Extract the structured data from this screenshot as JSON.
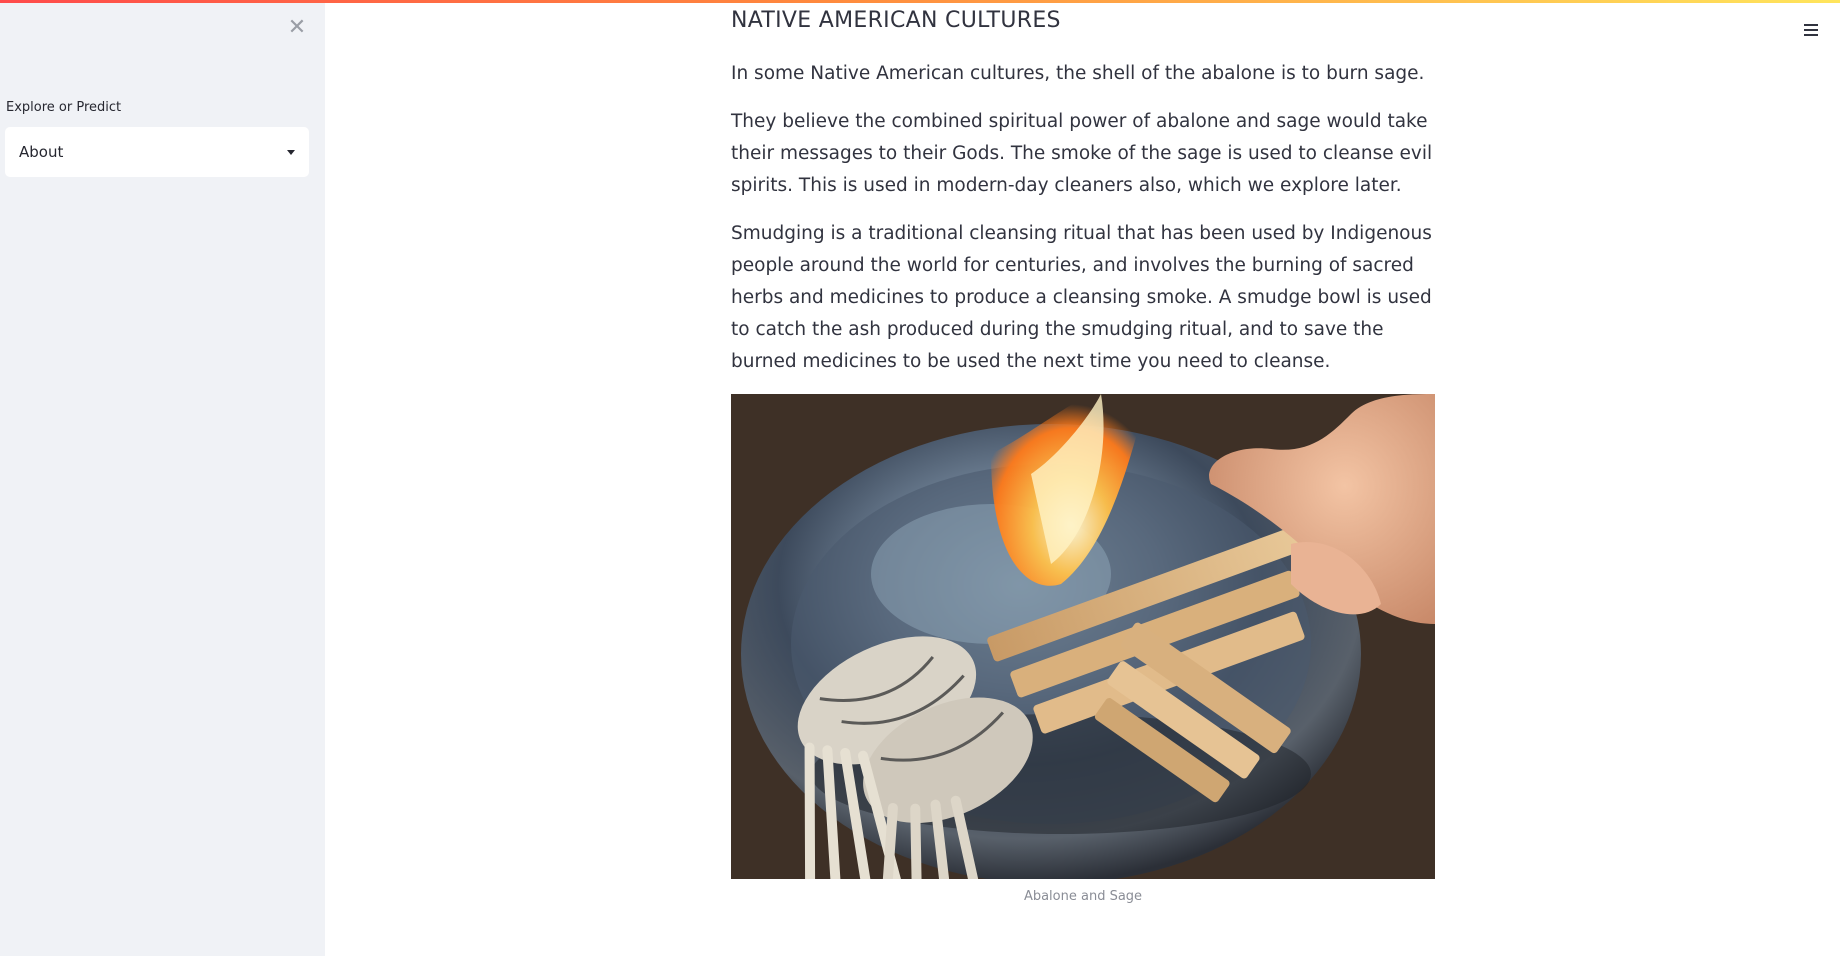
{
  "sidebar": {
    "select_label": "Explore or Predict",
    "select_value": "About"
  },
  "main": {
    "heading": "NATIVE AMERICAN CULTURES",
    "paragraphs": [
      "In some Native American cultures, the shell of the abalone is to burn sage.",
      "They believe the combined spiritual power of abalone and sage would take their messages to their Gods. The smoke of the sage is used to cleanse evil spirits. This is used in modern-day cleaners also, which we explore later.",
      "Smudging is a traditional cleansing ritual that has been used by Indigenous people around the world for centuries, and involves the burning of sacred herbs and medicines to produce a cleansing smoke. A smudge bowl is used to catch the ash produced during the smudging ritual, and to save the burned medicines to be used the next time you need to cleanse."
    ],
    "image_caption": "Abalone and Sage"
  },
  "icons": {
    "close": "close-icon",
    "menu": "hamburger-menu-icon",
    "dropdown": "chevron-down-icon"
  },
  "colors": {
    "sidebar_bg": "#f0f2f6",
    "text": "#31333f",
    "caption": "#8a8d96",
    "top_bar_start": "#ff4b4b",
    "top_bar_end": "#ffe55c"
  }
}
